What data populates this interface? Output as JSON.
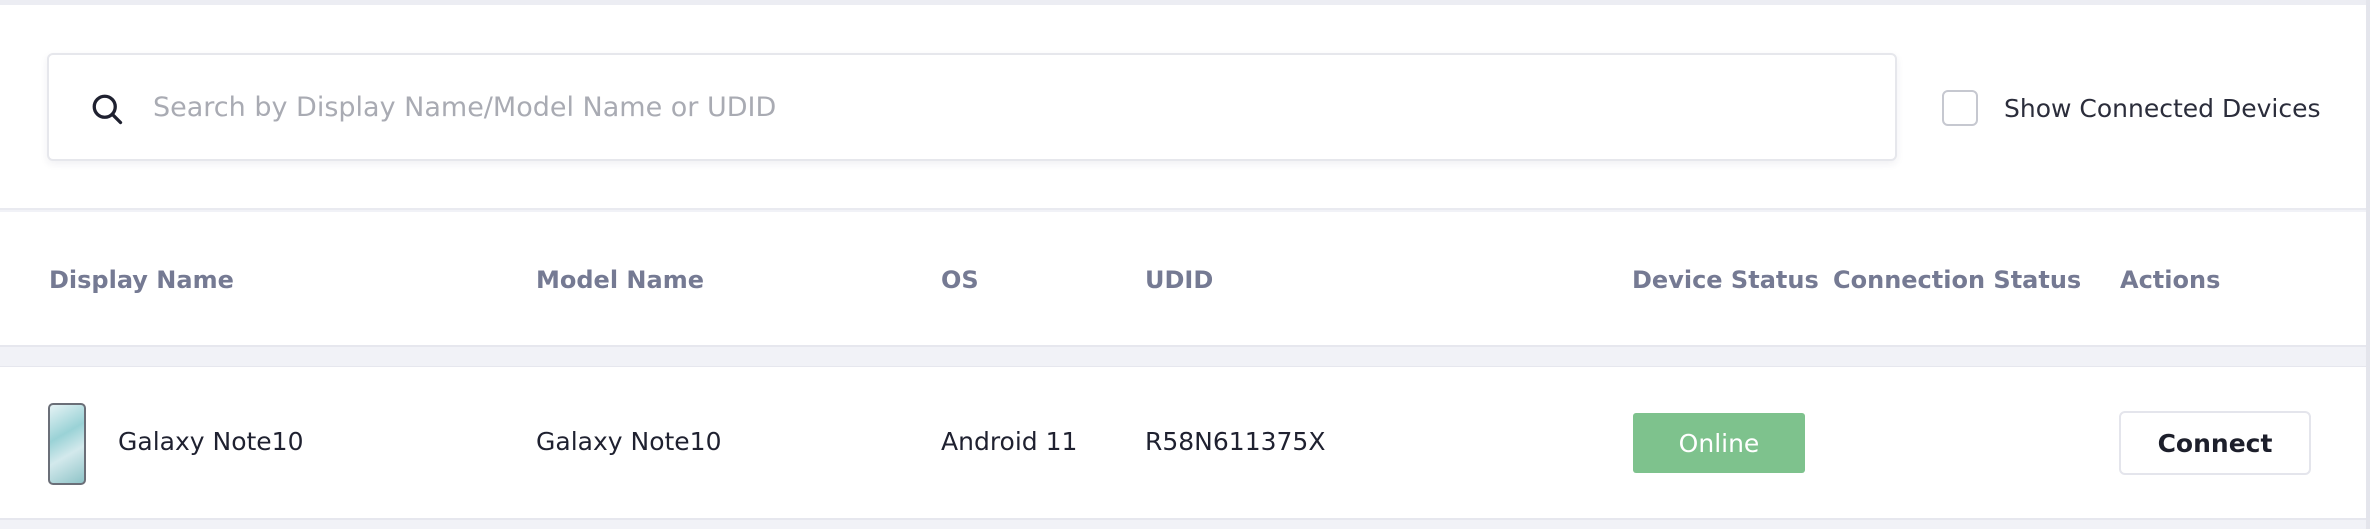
{
  "search": {
    "placeholder": "Search by Display Name/Model Name or UDID",
    "value": "",
    "icon": "search-icon"
  },
  "filter": {
    "label": "Show Connected Devices",
    "checked": false
  },
  "table": {
    "columns": {
      "display_name": "Display Name",
      "model_name": "Model Name",
      "os": "OS",
      "udid": "UDID",
      "device_status": "Device Status",
      "connection_status": "Connection Status",
      "actions": "Actions"
    },
    "rows": [
      {
        "thumbnail_icon": "phone-icon",
        "display_name": "Galaxy Note10",
        "model_name": "Galaxy Note10",
        "os": "Android 11",
        "udid": "R58N611375X",
        "device_status": "Online",
        "connection_status": "",
        "action_label": "Connect"
      }
    ]
  },
  "colors": {
    "status_online": "#7ec28d",
    "header_text": "#757a93",
    "background": "#f1f2f7"
  }
}
